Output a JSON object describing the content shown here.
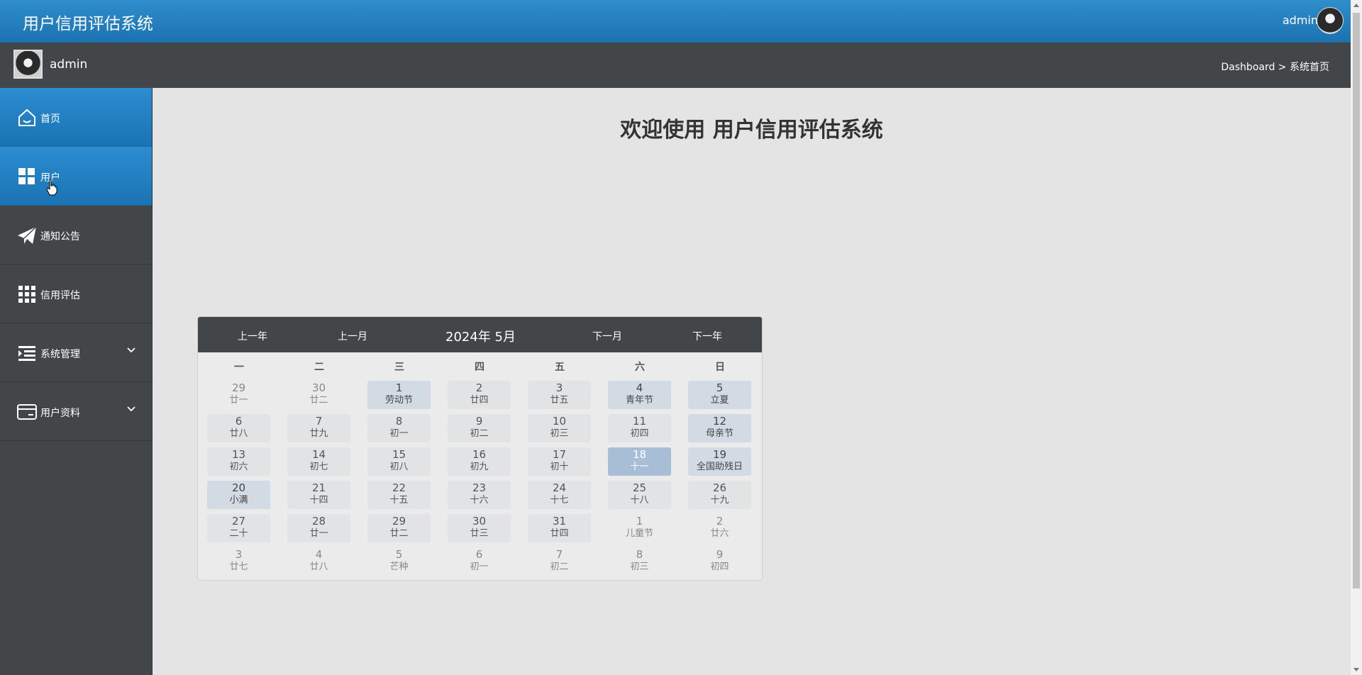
{
  "header": {
    "app_title": "用户信用评估系统",
    "user": "admin"
  },
  "subheader": {
    "username": "admin",
    "breadcrumb": "Dashboard > 系统首页"
  },
  "sidebar": {
    "items": [
      {
        "label": "首页",
        "icon": "home-icon"
      },
      {
        "label": "用户",
        "icon": "grid-icon"
      },
      {
        "label": "通知公告",
        "icon": "paper-plane-icon"
      },
      {
        "label": "信用评估",
        "icon": "apps-icon"
      },
      {
        "label": "系统管理",
        "icon": "list-icon"
      },
      {
        "label": "用户资料",
        "icon": "card-icon"
      }
    ]
  },
  "welcome": "欢迎使用 用户信用评估系统",
  "calendar": {
    "prev_year": "上一年",
    "prev_month": "上一月",
    "title": "2024年 5月",
    "next_month": "下一月",
    "next_year": "下一年",
    "weekdays": [
      "一",
      "二",
      "三",
      "四",
      "五",
      "六",
      "日"
    ],
    "weeks": [
      [
        [
          "29",
          "廿一",
          "other"
        ],
        [
          "30",
          "廿二",
          "other"
        ],
        [
          "1",
          "劳动节",
          "holiday"
        ],
        [
          "2",
          "廿四",
          "cur"
        ],
        [
          "3",
          "廿五",
          "cur"
        ],
        [
          "4",
          "青年节",
          "holiday"
        ],
        [
          "5",
          "立夏",
          "holiday"
        ]
      ],
      [
        [
          "6",
          "廿八",
          "cur"
        ],
        [
          "7",
          "廿九",
          "cur"
        ],
        [
          "8",
          "初一",
          "cur"
        ],
        [
          "9",
          "初二",
          "cur"
        ],
        [
          "10",
          "初三",
          "cur"
        ],
        [
          "11",
          "初四",
          "cur"
        ],
        [
          "12",
          "母亲节",
          "holiday"
        ]
      ],
      [
        [
          "13",
          "初六",
          "cur"
        ],
        [
          "14",
          "初七",
          "cur"
        ],
        [
          "15",
          "初八",
          "cur"
        ],
        [
          "16",
          "初九",
          "cur"
        ],
        [
          "17",
          "初十",
          "cur"
        ],
        [
          "18",
          "十一",
          "today"
        ],
        [
          "19",
          "全国助残日",
          "holiday"
        ]
      ],
      [
        [
          "20",
          "小满",
          "holiday"
        ],
        [
          "21",
          "十四",
          "cur"
        ],
        [
          "22",
          "十五",
          "cur"
        ],
        [
          "23",
          "十六",
          "cur"
        ],
        [
          "24",
          "十七",
          "cur"
        ],
        [
          "25",
          "十八",
          "cur"
        ],
        [
          "26",
          "十九",
          "cur"
        ]
      ],
      [
        [
          "27",
          "二十",
          "cur"
        ],
        [
          "28",
          "廿一",
          "cur"
        ],
        [
          "29",
          "廿二",
          "cur"
        ],
        [
          "30",
          "廿三",
          "cur"
        ],
        [
          "31",
          "廿四",
          "cur"
        ],
        [
          "1",
          "儿童节",
          "other"
        ],
        [
          "2",
          "廿六",
          "other"
        ]
      ],
      [
        [
          "3",
          "廿七",
          "other"
        ],
        [
          "4",
          "廿八",
          "other"
        ],
        [
          "5",
          "芒种",
          "other"
        ],
        [
          "6",
          "初一",
          "other"
        ],
        [
          "7",
          "初二",
          "other"
        ],
        [
          "8",
          "初三",
          "other"
        ],
        [
          "9",
          "初四",
          "other"
        ]
      ]
    ]
  },
  "colors": {
    "accent": "#2a86c6",
    "sidebar": "#434648",
    "today": "#a8bed6",
    "holiday": "#d2dae4"
  }
}
